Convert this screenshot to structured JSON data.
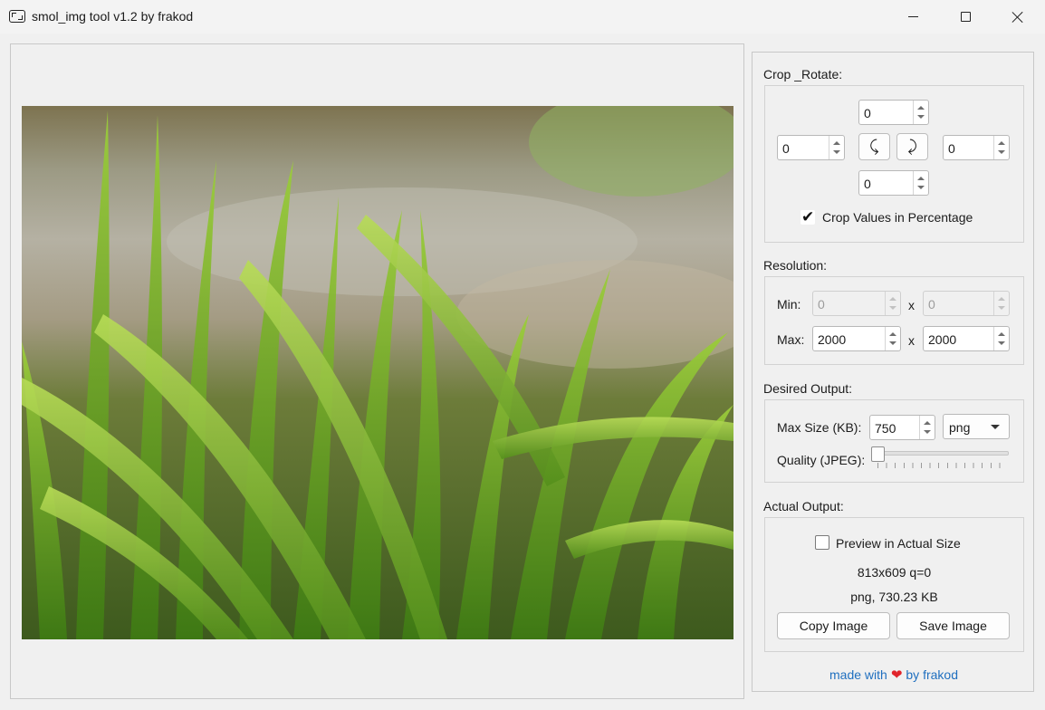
{
  "window": {
    "title": "smol_img tool v1.2 by frakod"
  },
  "crop": {
    "label": "Crop _Rotate:",
    "top": "0",
    "left": "0",
    "right": "0",
    "bottom": "0",
    "rotate_left_glyph": "⤹",
    "rotate_right_glyph": "⤸",
    "percentage_label": "Crop Values in Percentage",
    "percentage_checked": true
  },
  "resolution": {
    "label": "Resolution:",
    "min_label": "Min:",
    "min_w": "0",
    "min_h": "0",
    "max_label": "Max:",
    "max_w": "2000",
    "max_h": "2000",
    "x_sep": "x"
  },
  "desired": {
    "label": "Desired Output:",
    "max_size_label": "Max Size (KB):",
    "max_size": "750",
    "format": "png",
    "quality_label": "Quality (JPEG):",
    "quality_level": 0
  },
  "actual": {
    "label": "Actual Output:",
    "preview_label": "Preview in Actual Size",
    "preview_checked": false,
    "dims": "813x609 q=0",
    "format_size": "png, 730.23 KB",
    "copy_label": "Copy Image",
    "save_label": "Save Image"
  },
  "footer": {
    "made_with": "made with",
    "by": "by frakod"
  },
  "icons": {
    "app": "app-frame-icon",
    "heart": "heart-icon",
    "minimize": "minimize-icon",
    "maximize": "maximize-icon",
    "close": "close-icon"
  },
  "colors": {
    "link": "#1f6fbf",
    "heart": "#e0242b"
  }
}
